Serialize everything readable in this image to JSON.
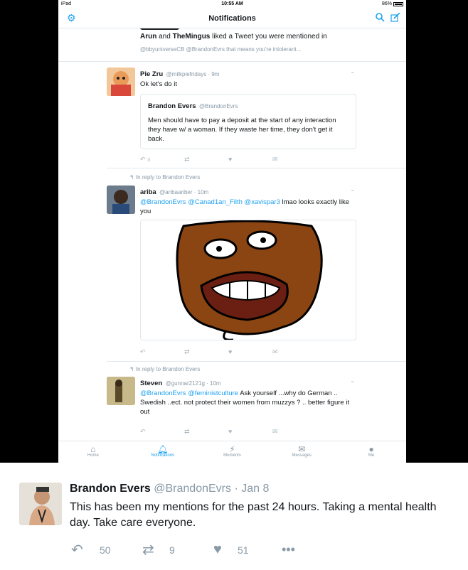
{
  "status": {
    "device": "iPad",
    "time": "10:55 AM",
    "battery": "86%"
  },
  "nav": {
    "title": "Notifications"
  },
  "notif": {
    "who1": "Arun",
    "and": "and",
    "who2": "TheMingus",
    "action": "liked a Tweet you were mentioned in",
    "preview": "@bbyuniverseCB @BrandonEvrs that means you're intolerant..."
  },
  "tweet1": {
    "name": "Pie Zru",
    "handle": "@milkpiefridays · 9m",
    "text": "Ok let's do it",
    "reply_count": "3",
    "quote": {
      "name": "Brandon Evers",
      "handle": "@BrandonEvrs",
      "text": "Men should have to pay a deposit at the start of any interaction they have w/ a woman. If they waste her time, they don't get it back."
    }
  },
  "tweet2": {
    "reply_to": "In reply to Brandon Evers",
    "name": "ariba",
    "handle": "@aribaariber · 10m",
    "mentions": "@BrandonEvrs @Canad1an_Filth @xavispar3",
    "text": " lmao looks exactly like you"
  },
  "tweet3": {
    "reply_to": "In reply to Brandon Evers",
    "name": "Steven",
    "handle": "@gunnar2121g · 10m",
    "mentions": "@BrandonEvrs @feministculture",
    "text": " Ask yourself ...why do German .. Swedish ..ect. not protect their women from muzzys ? .. better figure it out"
  },
  "tabs": [
    {
      "label": "Home",
      "icon": "home-icon"
    },
    {
      "label": "Notifications",
      "icon": "bell-icon"
    },
    {
      "label": "Moments",
      "icon": "lightning-icon"
    },
    {
      "label": "Messages",
      "icon": "envelope-icon"
    },
    {
      "label": "Me",
      "icon": "person-icon"
    }
  ],
  "main_tweet": {
    "name": "Brandon Evers",
    "handle": "@BrandonEvrs · Jan 8",
    "text": "This has been my mentions for the past 24 hours. Taking a mental health day. Take care everyone.",
    "replies": "50",
    "retweets": "9",
    "likes": "51"
  },
  "colors": {
    "accent": "#1da1f2",
    "muted": "#8899a6",
    "like": "#aab8c2"
  }
}
